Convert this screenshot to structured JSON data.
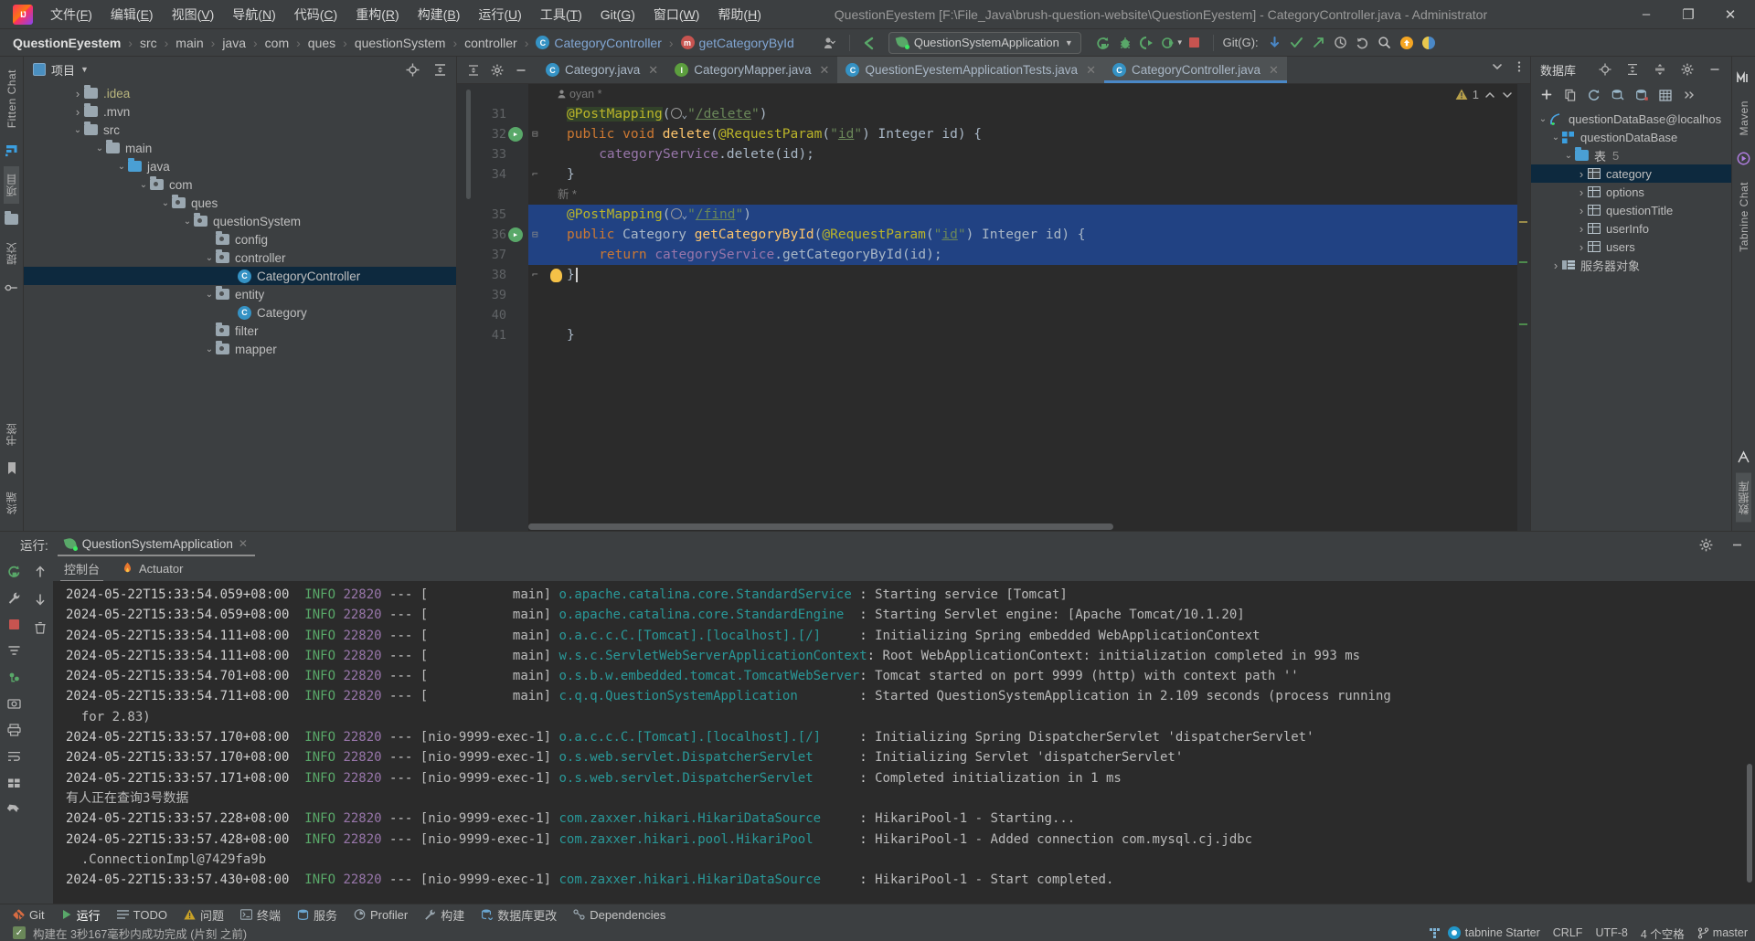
{
  "titlebar": {
    "logo_icon": "intellij-idea-logo",
    "menu": [
      {
        "label": "文件(F)"
      },
      {
        "label": "编辑(E)"
      },
      {
        "label": "视图(V)"
      },
      {
        "label": "导航(N)"
      },
      {
        "label": "代码(C)"
      },
      {
        "label": "重构(R)"
      },
      {
        "label": "构建(B)"
      },
      {
        "label": "运行(U)"
      },
      {
        "label": "工具(T)"
      },
      {
        "label": "Git(G)"
      },
      {
        "label": "窗口(W)"
      },
      {
        "label": "帮助(H)"
      }
    ],
    "window_title": "QuestionEyestem [F:\\File_Java\\brush-question-website\\QuestionEyestem] - CategoryController.java - Administrator",
    "minimize": "–",
    "maximize": "❐",
    "close": "✕"
  },
  "navbar": {
    "breadcrumbs": [
      {
        "label": "QuestionEyestem",
        "style": "bold"
      },
      {
        "label": "src",
        "style": "plain"
      },
      {
        "label": "main",
        "style": "plain"
      },
      {
        "label": "java",
        "style": "plain"
      },
      {
        "label": "com",
        "style": "plain"
      },
      {
        "label": "ques",
        "style": "plain"
      },
      {
        "label": "questionSystem",
        "style": "plain"
      },
      {
        "label": "controller",
        "style": "plain"
      },
      {
        "label": "CategoryController",
        "style": "class"
      },
      {
        "label": "getCategoryById",
        "style": "method"
      }
    ],
    "class_badge": "C",
    "method_badge": "m",
    "run_config": "QuestionSystemApplication",
    "git_label": "Git(G):",
    "icons": [
      "user-settings-icon",
      "back-arrow-icon",
      "rerun-icon",
      "debug-icon",
      "coverage-icon",
      "profile-icon",
      "stop-icon",
      "git-update-icon",
      "git-commit-icon",
      "git-push-icon",
      "history-icon",
      "rollback-icon",
      "search-icon",
      "update-badge-icon",
      "ai-assistant-icon"
    ]
  },
  "left_strip": {
    "items": [
      {
        "label": "Fitten Chat",
        "type": "vtext"
      },
      {
        "label": "",
        "type": "icon",
        "icon": "fitten-logo-icon"
      },
      {
        "label": "项目",
        "type": "vtext",
        "selected": true
      },
      {
        "label": "",
        "type": "icon",
        "icon": "folder-icon"
      },
      {
        "label": "提交",
        "type": "vtext"
      },
      {
        "label": "",
        "type": "icon",
        "icon": "structure-icon"
      }
    ],
    "bottom_items": [
      {
        "label": "书签",
        "type": "vtext"
      },
      {
        "label": "",
        "type": "icon",
        "icon": "bookmark-icon"
      },
      {
        "label": "终端",
        "type": "vtext"
      }
    ]
  },
  "right_strip": {
    "items": [
      {
        "label": "Maven",
        "icon": "maven-icon"
      },
      {
        "label": "Tabnine Chat",
        "icon": "tabnine-icon"
      },
      {
        "label": "数据库",
        "icon": "database-icon"
      }
    ]
  },
  "project_panel": {
    "title": "项目",
    "dropdown_icon": "chevron-down-icon",
    "locate_icon": "locate-target-icon",
    "collapse_icon": "collapse-all-icon",
    "tree": [
      {
        "label": ".idea",
        "depth": 1,
        "arrow": "collapsed",
        "icon": "folder",
        "color": "yellow",
        "selected": false
      },
      {
        "label": ".mvn",
        "depth": 1,
        "arrow": "collapsed",
        "icon": "folder",
        "color": "normal",
        "selected": false
      },
      {
        "label": "src",
        "depth": 1,
        "arrow": "expanded",
        "icon": "folder",
        "color": "normal",
        "selected": false
      },
      {
        "label": "main",
        "depth": 2,
        "arrow": "expanded",
        "icon": "folder",
        "color": "normal",
        "selected": false
      },
      {
        "label": "java",
        "depth": 3,
        "arrow": "expanded",
        "icon": "folder-blue",
        "color": "normal",
        "selected": false
      },
      {
        "label": "com",
        "depth": 4,
        "arrow": "expanded",
        "icon": "package",
        "color": "normal",
        "selected": false
      },
      {
        "label": "ques",
        "depth": 5,
        "arrow": "expanded",
        "icon": "package",
        "color": "normal",
        "selected": false
      },
      {
        "label": "questionSystem",
        "depth": 6,
        "arrow": "expanded",
        "icon": "package",
        "color": "normal",
        "selected": false
      },
      {
        "label": "config",
        "depth": 7,
        "arrow": "none",
        "icon": "package",
        "color": "normal",
        "selected": false
      },
      {
        "label": "controller",
        "depth": 7,
        "arrow": "expanded",
        "icon": "package",
        "color": "normal",
        "selected": false
      },
      {
        "label": "CategoryController",
        "depth": 8,
        "arrow": "none",
        "icon": "java-class",
        "color": "normal",
        "selected": true
      },
      {
        "label": "entity",
        "depth": 7,
        "arrow": "expanded",
        "icon": "package",
        "color": "normal",
        "selected": false
      },
      {
        "label": "Category",
        "depth": 8,
        "arrow": "none",
        "icon": "java-class",
        "color": "normal",
        "selected": false
      },
      {
        "label": "filter",
        "depth": 7,
        "arrow": "none",
        "icon": "package",
        "color": "normal",
        "selected": false
      },
      {
        "label": "mapper",
        "depth": 7,
        "arrow": "expanded",
        "icon": "package",
        "color": "normal",
        "selected": false
      }
    ]
  },
  "editor": {
    "tabs": [
      {
        "label": "Category.java",
        "icon": "java-class-icon",
        "badge": "C",
        "badge_color": "#3592c4",
        "active": false,
        "closable": true
      },
      {
        "label": "CategoryMapper.java",
        "icon": "java-interface-icon",
        "badge": "I",
        "badge_color": "#5c9e3e",
        "active": false,
        "closable": true
      },
      {
        "label": "QuestionEyestemApplicationTests.java",
        "icon": "spring-test-icon",
        "badge": "C",
        "badge_color": "#3592c4",
        "active": false,
        "alt": true,
        "closable": true
      },
      {
        "label": "CategoryController.java",
        "icon": "java-class-icon",
        "badge": "C",
        "badge_color": "#3592c4",
        "active": true,
        "closable": true
      }
    ],
    "tab_list_icon": "chevron-down-icon",
    "tab_more_icon": "more-vertical-icon",
    "warning_count": "1",
    "warning_icon": "warning-triangle-icon",
    "prev_icon": "chevron-up-icon",
    "next_icon": "chevron-down-icon",
    "hints": [
      {
        "text": "oyan *",
        "icon": "user-icon"
      },
      {
        "text": "新 *",
        "icon": ""
      }
    ],
    "code_lines": [
      {
        "num": "31",
        "indent": 0,
        "highlight": false,
        "tokens": [
          {
            "t": "@PostMapping",
            "c": "anno",
            "bg": true
          },
          {
            "t": "(",
            "c": "pun"
          },
          {
            "t": "globe",
            "c": "icon"
          },
          {
            "t": "\"",
            "c": "str"
          },
          {
            "t": "/delete",
            "c": "str-link"
          },
          {
            "t": "\"",
            "c": "str"
          },
          {
            "t": ")",
            "c": "pun"
          }
        ]
      },
      {
        "num": "32",
        "indent": 0,
        "highlight": false,
        "gutter_icon": "run-method-icon",
        "fold": "open",
        "tokens": [
          {
            "t": "public",
            "c": "kw"
          },
          {
            "t": " ",
            "c": "pun"
          },
          {
            "t": "void",
            "c": "kw"
          },
          {
            "t": " ",
            "c": "pun"
          },
          {
            "t": "delete",
            "c": "fn"
          },
          {
            "t": "(",
            "c": "pun"
          },
          {
            "t": "@RequestParam",
            "c": "anno"
          },
          {
            "t": "(",
            "c": "pun"
          },
          {
            "t": "\"",
            "c": "str"
          },
          {
            "t": "id",
            "c": "str-link"
          },
          {
            "t": "\"",
            "c": "str"
          },
          {
            "t": ")",
            "c": "pun"
          },
          {
            "t": " Integer id",
            "c": "typ"
          },
          {
            "t": ") {",
            "c": "pun"
          }
        ]
      },
      {
        "num": "33",
        "indent": 1,
        "highlight": false,
        "tokens": [
          {
            "t": "categoryService",
            "c": "fld"
          },
          {
            "t": ".",
            "c": "pun"
          },
          {
            "t": "delete",
            "c": "typ"
          },
          {
            "t": "(id);",
            "c": "pun"
          }
        ]
      },
      {
        "num": "34",
        "indent": 0,
        "highlight": false,
        "fold": "close",
        "tokens": [
          {
            "t": "}",
            "c": "pun"
          }
        ]
      },
      {
        "num": "35",
        "indent": 0,
        "highlight": true,
        "tokens": [
          {
            "t": "@PostMapping",
            "c": "anno"
          },
          {
            "t": "(",
            "c": "pun"
          },
          {
            "t": "globe",
            "c": "icon"
          },
          {
            "t": "\"",
            "c": "str"
          },
          {
            "t": "/find",
            "c": "str-link"
          },
          {
            "t": "\"",
            "c": "str"
          },
          {
            "t": ")",
            "c": "pun"
          }
        ]
      },
      {
        "num": "36",
        "indent": 0,
        "highlight": true,
        "gutter_icon": "run-method-icon",
        "fold": "open",
        "tokens": [
          {
            "t": "public",
            "c": "kw"
          },
          {
            "t": " Category ",
            "c": "typ"
          },
          {
            "t": "getCategoryById",
            "c": "fn"
          },
          {
            "t": "(",
            "c": "pun"
          },
          {
            "t": "@RequestParam",
            "c": "anno"
          },
          {
            "t": "(",
            "c": "pun"
          },
          {
            "t": "\"",
            "c": "str"
          },
          {
            "t": "id",
            "c": "str-link"
          },
          {
            "t": "\"",
            "c": "str"
          },
          {
            "t": ")",
            "c": "pun"
          },
          {
            "t": " Integer id",
            "c": "typ"
          },
          {
            "t": ") {",
            "c": "pun"
          }
        ]
      },
      {
        "num": "37",
        "indent": 1,
        "highlight": true,
        "tokens": [
          {
            "t": "return",
            "c": "kw"
          },
          {
            "t": " ",
            "c": "pun"
          },
          {
            "t": "categoryService",
            "c": "fld"
          },
          {
            "t": ".",
            "c": "pun"
          },
          {
            "t": "getCategoryById",
            "c": "typ"
          },
          {
            "t": "(id);",
            "c": "pun"
          }
        ]
      },
      {
        "num": "38",
        "indent": 0,
        "highlight": false,
        "fold": "close",
        "bulb": true,
        "caret": true,
        "tokens": [
          {
            "t": "}",
            "c": "pun"
          }
        ]
      },
      {
        "num": "39",
        "indent": 0,
        "highlight": false,
        "tokens": []
      },
      {
        "num": "40",
        "indent": 0,
        "highlight": false,
        "tokens": []
      },
      {
        "num": "41",
        "indent": 0,
        "highlight": false,
        "tokens": [
          {
            "t": "}",
            "c": "pun"
          }
        ]
      }
    ]
  },
  "db_panel": {
    "title": "数据库",
    "header_icons": [
      "locate-target-icon",
      "expand-all-icon",
      "collapse-all-icon",
      "gear-icon",
      "minimize-icon"
    ],
    "toolbar_icons": [
      "add-icon",
      "copy-icon",
      "refresh-icon",
      "query-console-icon",
      "data-source-icon",
      "table-icon",
      "more-icon"
    ],
    "tree": [
      {
        "label": "questionDataBase@localhos",
        "depth": 0,
        "arrow": "expanded",
        "icon": "db-connection-icon",
        "selected": false
      },
      {
        "label": "questionDataBase",
        "depth": 1,
        "arrow": "expanded",
        "icon": "schema-icon",
        "selected": false
      },
      {
        "label": "表",
        "count": "5",
        "depth": 2,
        "arrow": "expanded",
        "icon": "folder-blue",
        "selected": false
      },
      {
        "label": "category",
        "depth": 3,
        "arrow": "collapsed",
        "icon": "table-icon",
        "selected": true
      },
      {
        "label": "options",
        "depth": 3,
        "arrow": "collapsed",
        "icon": "table-icon",
        "selected": false
      },
      {
        "label": "questionTitle",
        "depth": 3,
        "arrow": "collapsed",
        "icon": "table-icon",
        "selected": false
      },
      {
        "label": "userInfo",
        "depth": 3,
        "arrow": "collapsed",
        "icon": "table-icon",
        "selected": false
      },
      {
        "label": "users",
        "depth": 3,
        "arrow": "collapsed",
        "icon": "table-icon",
        "selected": false
      },
      {
        "label": "服务器对象",
        "depth": 1,
        "arrow": "collapsed",
        "icon": "server-objects-icon",
        "selected": false
      }
    ]
  },
  "run_panel": {
    "label": "运行:",
    "config_name": "QuestionSystemApplication",
    "close_icon": "close-icon",
    "settings_icon": "gear-icon",
    "minimize_icon": "minimize-icon",
    "console_tabs": [
      {
        "label": "控制台",
        "active": true,
        "icon": ""
      },
      {
        "label": "Actuator",
        "active": false,
        "icon": "actuator-icon"
      }
    ],
    "side_icons": [
      "rerun-icon",
      "wrench-icon",
      "stop-icon",
      "filter-icon",
      "thread-dump-icon",
      "camera-icon",
      "print-icon",
      "soft-wrap-icon",
      "grid-icon",
      "trash-icon",
      "pin-icon"
    ],
    "log": [
      {
        "ts": "2024-05-22T15:33:54.059+08:00",
        "lvl": "INFO",
        "pid": "22820",
        "thread": "main",
        "logger": "o.apache.catalina.core.StandardService",
        "msg": "Starting service [Tomcat]"
      },
      {
        "ts": "2024-05-22T15:33:54.059+08:00",
        "lvl": "INFO",
        "pid": "22820",
        "thread": "main",
        "logger": "o.apache.catalina.core.StandardEngine",
        "msg": "Starting Servlet engine: [Apache Tomcat/10.1.20]"
      },
      {
        "ts": "2024-05-22T15:33:54.111+08:00",
        "lvl": "INFO",
        "pid": "22820",
        "thread": "main",
        "logger": "o.a.c.c.C.[Tomcat].[localhost].[/]",
        "msg": "Initializing Spring embedded WebApplicationContext"
      },
      {
        "ts": "2024-05-22T15:33:54.111+08:00",
        "lvl": "INFO",
        "pid": "22820",
        "thread": "main",
        "logger": "w.s.c.ServletWebServerApplicationContext",
        "msg": "Root WebApplicationContext: initialization completed in 993 ms"
      },
      {
        "ts": "2024-05-22T15:33:54.701+08:00",
        "lvl": "INFO",
        "pid": "22820",
        "thread": "main",
        "logger": "o.s.b.w.embedded.tomcat.TomcatWebServer",
        "msg": "Tomcat started on port 9999 (http) with context path ''"
      },
      {
        "ts": "2024-05-22T15:33:54.711+08:00",
        "lvl": "INFO",
        "pid": "22820",
        "thread": "main",
        "logger": "c.q.q.QuestionSystemApplication",
        "msg": "Started QuestionSystemApplication in 2.109 seconds (process running"
      },
      {
        "cont": "  for 2.83)"
      },
      {
        "ts": "2024-05-22T15:33:57.170+08:00",
        "lvl": "INFO",
        "pid": "22820",
        "thread": "nio-9999-exec-1",
        "logger": "o.a.c.c.C.[Tomcat].[localhost].[/]",
        "msg": "Initializing Spring DispatcherServlet 'dispatcherServlet'"
      },
      {
        "ts": "2024-05-22T15:33:57.170+08:00",
        "lvl": "INFO",
        "pid": "22820",
        "thread": "nio-9999-exec-1",
        "logger": "o.s.web.servlet.DispatcherServlet",
        "msg": "Initializing Servlet 'dispatcherServlet'"
      },
      {
        "ts": "2024-05-22T15:33:57.171+08:00",
        "lvl": "INFO",
        "pid": "22820",
        "thread": "nio-9999-exec-1",
        "logger": "o.s.web.servlet.DispatcherServlet",
        "msg": "Completed initialization in 1 ms"
      },
      {
        "cont": "有人正在查询3号数据"
      },
      {
        "ts": "2024-05-22T15:33:57.228+08:00",
        "lvl": "INFO",
        "pid": "22820",
        "thread": "nio-9999-exec-1",
        "logger": "com.zaxxer.hikari.HikariDataSource",
        "msg": "HikariPool-1 - Starting..."
      },
      {
        "ts": "2024-05-22T15:33:57.428+08:00",
        "lvl": "INFO",
        "pid": "22820",
        "thread": "nio-9999-exec-1",
        "logger": "com.zaxxer.hikari.pool.HikariPool",
        "msg": "HikariPool-1 - Added connection com.mysql.cj.jdbc"
      },
      {
        "cont": "  .ConnectionImpl@7429fa9b"
      },
      {
        "ts": "2024-05-22T15:33:57.430+08:00",
        "lvl": "INFO",
        "pid": "22820",
        "thread": "nio-9999-exec-1",
        "logger": "com.zaxxer.hikari.HikariDataSource",
        "msg": "HikariPool-1 - Start completed."
      }
    ]
  },
  "statusbar": {
    "items": [
      {
        "label": "Git",
        "icon": "git-icon",
        "active": false
      },
      {
        "label": "运行",
        "icon": "run-icon",
        "active": true
      },
      {
        "label": "TODO",
        "icon": "todo-icon",
        "active": false
      },
      {
        "label": "问题",
        "icon": "problems-icon",
        "active": false
      },
      {
        "label": "终端",
        "icon": "terminal-icon",
        "active": false
      },
      {
        "label": "服务",
        "icon": "services-icon",
        "active": false
      },
      {
        "label": "Profiler",
        "icon": "profiler-icon",
        "active": false
      },
      {
        "label": "构建",
        "icon": "build-icon",
        "active": false
      },
      {
        "label": "数据库更改",
        "icon": "db-changes-icon",
        "active": false
      },
      {
        "label": "Dependencies",
        "icon": "dependencies-icon",
        "active": false
      }
    ],
    "build_message": "构建在 3秒167毫秒内成功完成 (片刻 之前)",
    "build_icon": "build-success-icon",
    "right": {
      "tabnine_label": "tabnine Starter",
      "line_separator": "CRLF",
      "encoding": "UTF-8",
      "indent": "4 个空格",
      "branch": "master",
      "branch_icon": "git-branch-icon"
    }
  }
}
